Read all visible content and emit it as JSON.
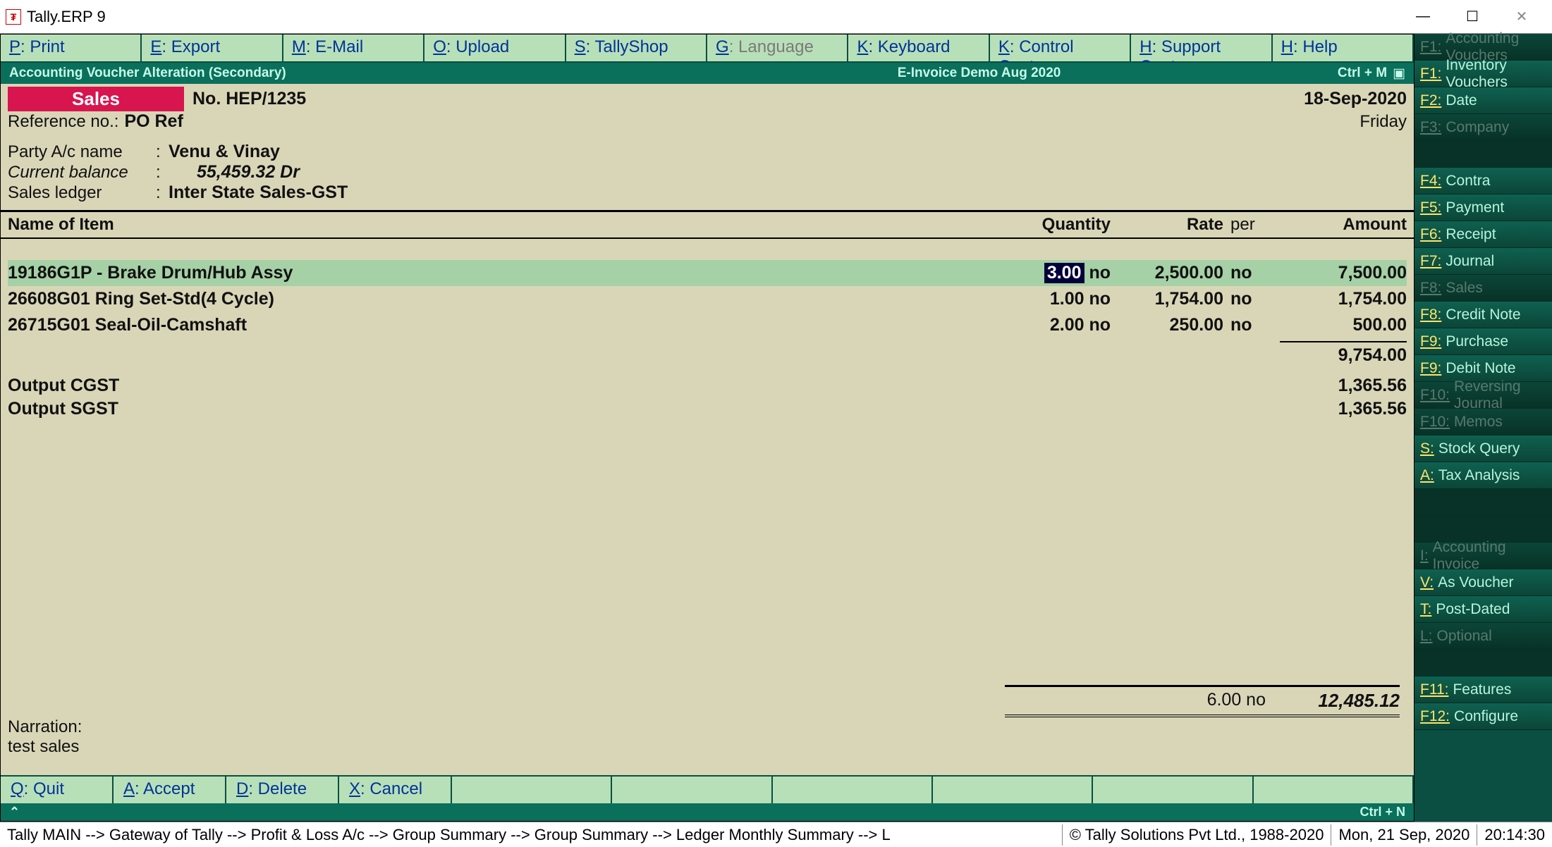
{
  "window": {
    "title": "Tally.ERP 9"
  },
  "cmdbar": [
    {
      "key": "P",
      "label": ": Print",
      "disabled": false
    },
    {
      "key": "E",
      "label": ": Export",
      "disabled": false
    },
    {
      "key": "M",
      "label": ": E-Mail",
      "disabled": false
    },
    {
      "key": "O",
      "label": ": Upload",
      "disabled": false
    },
    {
      "key": "S",
      "label": ": TallyShop",
      "disabled": false
    },
    {
      "key": "G",
      "label": ": Language",
      "disabled": true
    },
    {
      "key": "K",
      "label": ": Keyboard",
      "disabled": false
    },
    {
      "key": "K",
      "label": ": Control Centre",
      "disabled": false
    },
    {
      "key": "H",
      "label": ": Support Centre",
      "disabled": false
    },
    {
      "key": "H",
      "label": ": Help",
      "disabled": false
    }
  ],
  "greenstrip": {
    "left": "Accounting Voucher  Alteration  (Secondary)",
    "mid": "E-Invoice Demo Aug 2020",
    "right": "Ctrl + M"
  },
  "voucher": {
    "type": "Sales",
    "no_label": "No.",
    "no": "HEP/1235",
    "date": "18-Sep-2020",
    "day": "Friday",
    "refno_label": "Reference no.:",
    "refno": "PO Ref"
  },
  "party": {
    "name_label": "Party A/c name",
    "name": "Venu & Vinay",
    "bal_label": "Current balance",
    "bal": "55,459.32 Dr",
    "ledger_label": "Sales ledger",
    "ledger": "Inter State Sales-GST"
  },
  "headers": {
    "name": "Name of Item",
    "qty": "Quantity",
    "rate": "Rate",
    "per": "per",
    "amount": "Amount"
  },
  "items": [
    {
      "name": "19186G1P - Brake Drum/Hub Assy",
      "qty_edit": "3.00",
      "qty_unit": "no",
      "rate": "2,500.00",
      "per": "no",
      "amount": "7,500.00",
      "hilite": true
    },
    {
      "name": "26608G01 Ring Set-Std(4 Cycle)",
      "qty": "1.00 no",
      "rate": "1,754.00",
      "per": "no",
      "amount": "1,754.00",
      "hilite": false
    },
    {
      "name": "26715G01 Seal-Oil-Camshaft",
      "qty": "2.00 no",
      "rate": "250.00",
      "per": "no",
      "amount": "500.00",
      "hilite": false
    }
  ],
  "subtotal": "9,754.00",
  "taxes": [
    {
      "name": "Output CGST",
      "amount": "1,365.56"
    },
    {
      "name": "Output SGST",
      "amount": "1,365.56"
    }
  ],
  "totals": {
    "qty": "6.00 no",
    "amount": "12,485.12"
  },
  "narration": {
    "label": "Narration:",
    "text": "test sales"
  },
  "bottombar": [
    {
      "key": "Q",
      "label": ": Quit"
    },
    {
      "key": "A",
      "label": ": Accept"
    },
    {
      "key": "D",
      "label": ": Delete"
    },
    {
      "key": "X",
      "label": ": Cancel"
    }
  ],
  "ctrlN": "Ctrl + N",
  "statusbar": {
    "path": "Tally MAIN --> Gateway of Tally --> Profit & Loss A/c --> Group Summary --> Group Summary --> Ledger Monthly Summary --> L",
    "copyright": "© Tally Solutions Pvt Ltd., 1988-2020",
    "date": "Mon, 21 Sep, 2020",
    "time": "20:14:30"
  },
  "sidebtns": [
    {
      "key": "F1",
      "label": "Accounting Vouchers",
      "disabled": true
    },
    {
      "key": "F1",
      "label": "Inventory Vouchers",
      "disabled": false
    },
    {
      "key": "F2",
      "label": "Date",
      "disabled": false
    },
    {
      "key": "F3",
      "label": "Company",
      "disabled": true
    },
    {
      "gap": true
    },
    {
      "key": "F4",
      "label": "Contra",
      "disabled": false
    },
    {
      "key": "F5",
      "label": "Payment",
      "disabled": false
    },
    {
      "key": "F6",
      "label": "Receipt",
      "disabled": false
    },
    {
      "key": "F7",
      "label": "Journal",
      "disabled": false
    },
    {
      "key": "F8",
      "label": "Sales",
      "disabled": true
    },
    {
      "key": "F8",
      "label": "Credit Note",
      "disabled": false,
      "underline": true
    },
    {
      "key": "F9",
      "label": "Purchase",
      "disabled": false
    },
    {
      "key": "F9",
      "label": "Debit Note",
      "disabled": false,
      "underline": true
    },
    {
      "key": "F10",
      "label": "Reversing Journal",
      "disabled": true
    },
    {
      "key": "F10",
      "label": "Memos",
      "disabled": true
    },
    {
      "key": "S",
      "label": "Stock Query",
      "disabled": false
    },
    {
      "key": "A",
      "label": "Tax Analysis",
      "disabled": false
    },
    {
      "gap": true
    },
    {
      "gap": true
    },
    {
      "key": "I",
      "label": "Accounting Invoice",
      "disabled": true
    },
    {
      "key": "V",
      "label": "As Voucher",
      "disabled": false
    },
    {
      "key": "T",
      "label": "Post-Dated",
      "disabled": false
    },
    {
      "key": "L",
      "label": "Optional",
      "disabled": true
    },
    {
      "gap": true
    },
    {
      "key": "F11",
      "label": "Features",
      "disabled": false
    },
    {
      "key": "F12",
      "label": "Configure",
      "disabled": false
    }
  ]
}
